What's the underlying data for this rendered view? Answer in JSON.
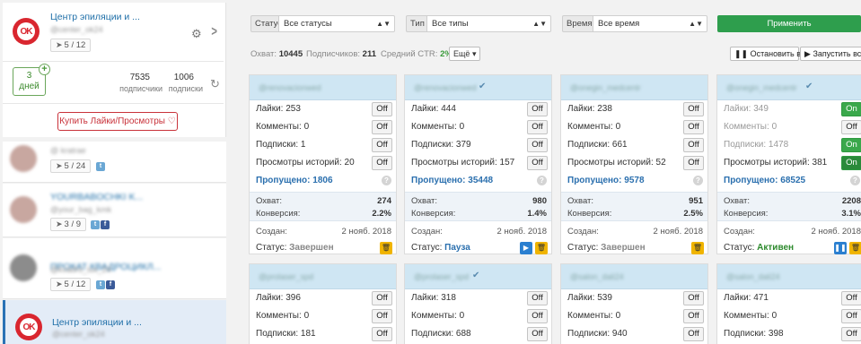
{
  "sidebar": {
    "current": {
      "name": "Центр эпиляции и ...",
      "handle": "@center_ok24",
      "tasks": "5 / 12",
      "days_number": "3",
      "days_label": "дней",
      "subscribers_count": "7535",
      "subscribers_label": "подписчики",
      "following_count": "1006",
      "following_label": "подписки",
      "buy_button": "Купить Лайки/Просмотры ♡"
    },
    "accounts": [
      {
        "name": "",
        "handle": "@ kratrae",
        "tasks": "5 / 24",
        "socials": [
          "twitter"
        ]
      },
      {
        "name": "YOURBABOCHKI K...",
        "handle": "@your_bag_kmk",
        "tasks": "3 / 9",
        "socials": [
          "twitter",
          "facebook"
        ]
      },
      {
        "name": "ПРОКАТ КВАДРОЦИКЛ...",
        "handle": "@kvadro_lux_24",
        "tasks": "5 / 12",
        "socials": [
          "twitter",
          "facebook"
        ]
      },
      {
        "name": "Центр эпиляции и ...",
        "handle": "@center_ok24",
        "tasks": "",
        "socials": []
      }
    ]
  },
  "filters": {
    "status_label": "Статус",
    "status_value": "Все статусы",
    "type_label": "Тип",
    "type_value": "Все типы",
    "time_label": "Время",
    "time_value": "Все время",
    "apply": "Применить"
  },
  "summary": {
    "reach_label": "Охват:",
    "reach_value": "10445",
    "subs_label": "Подписчиков:",
    "subs_value": "211",
    "ctr_label": "Средний CTR:",
    "ctr_value": "2%",
    "more": "Ещё",
    "stop_all": "Остановить все",
    "start_all": "Запустить все"
  },
  "labels": {
    "likes": "Лайки:",
    "comments": "Комменты:",
    "subscriptions": "Подписки:",
    "story_views": "Просмотры историй:",
    "skipped": "Пропущено:",
    "reach": "Охват:",
    "conversion": "Конверсия:",
    "created": "Создан:",
    "status": "Статус:"
  },
  "cards": [
    {
      "handle": "@renovacionwed",
      "likes": "253",
      "likes_t": "Off",
      "comments": "0",
      "comments_t": "Off",
      "subs": "1",
      "subs_t": "Off",
      "stories": "20",
      "stories_t": "Off",
      "skipped": "1806",
      "reach": "274",
      "conversion": "2.2%",
      "created": "2 нояб. 2018",
      "status": "Завершен"
    },
    {
      "handle": "@renovacionwed",
      "likes": "444",
      "likes_t": "Off",
      "comments": "0",
      "comments_t": "Off",
      "subs": "379",
      "subs_t": "Off",
      "stories": "157",
      "stories_t": "Off",
      "skipped": "35448",
      "reach": "980",
      "conversion": "1.4%",
      "created": "2 нояб. 2018",
      "status": "Пауза"
    },
    {
      "handle": "@onegin_medcentr",
      "likes": "238",
      "likes_t": "Off",
      "comments": "0",
      "comments_t": "Off",
      "subs": "661",
      "subs_t": "Off",
      "stories": "52",
      "stories_t": "Off",
      "skipped": "9578",
      "reach": "951",
      "conversion": "2.5%",
      "created": "2 нояб. 2018",
      "status": "Завершен"
    },
    {
      "handle": "@onegin_medcentr",
      "likes": "349",
      "likes_t": "On",
      "comments": "0",
      "comments_t": "Off",
      "subs": "1478",
      "subs_t": "On",
      "stories": "381",
      "stories_t": "On",
      "skipped": "68525",
      "reach": "2208",
      "conversion": "3.1%",
      "created": "2 нояб. 2018",
      "status": "Активен"
    },
    {
      "handle": "@prolaser_spd",
      "likes": "396",
      "likes_t": "Off",
      "comments": "0",
      "comments_t": "Off",
      "subs": "181",
      "subs_t": "Off"
    },
    {
      "handle": "@prolaser_spd",
      "likes": "318",
      "likes_t": "Off",
      "comments": "0",
      "comments_t": "Off",
      "subs": "688",
      "subs_t": "Off"
    },
    {
      "handle": "@salon_dali24",
      "likes": "539",
      "likes_t": "Off",
      "comments": "0",
      "comments_t": "Off",
      "subs": "940",
      "subs_t": "Off"
    },
    {
      "handle": "@salon_dali24",
      "likes": "471",
      "likes_t": "Off",
      "comments": "0",
      "comments_t": "Off",
      "subs": "398",
      "subs_t": "Off"
    }
  ],
  "icons": {
    "settings": "gear-icon",
    "next": "chevron-right-icon",
    "refresh": "refresh-icon",
    "rocket": "rocket-icon",
    "help": "question-icon",
    "delete": "trash-icon",
    "play": "play-icon",
    "pause": "pause-icon"
  },
  "colors": {
    "accent_blue": "#2a6fae",
    "apply_green": "#2e9e4d",
    "toggle_on": "#3aa84b",
    "card_header": "#cfe6f3",
    "trash_yellow": "#f0b400",
    "brand_red": "#d9262f"
  }
}
